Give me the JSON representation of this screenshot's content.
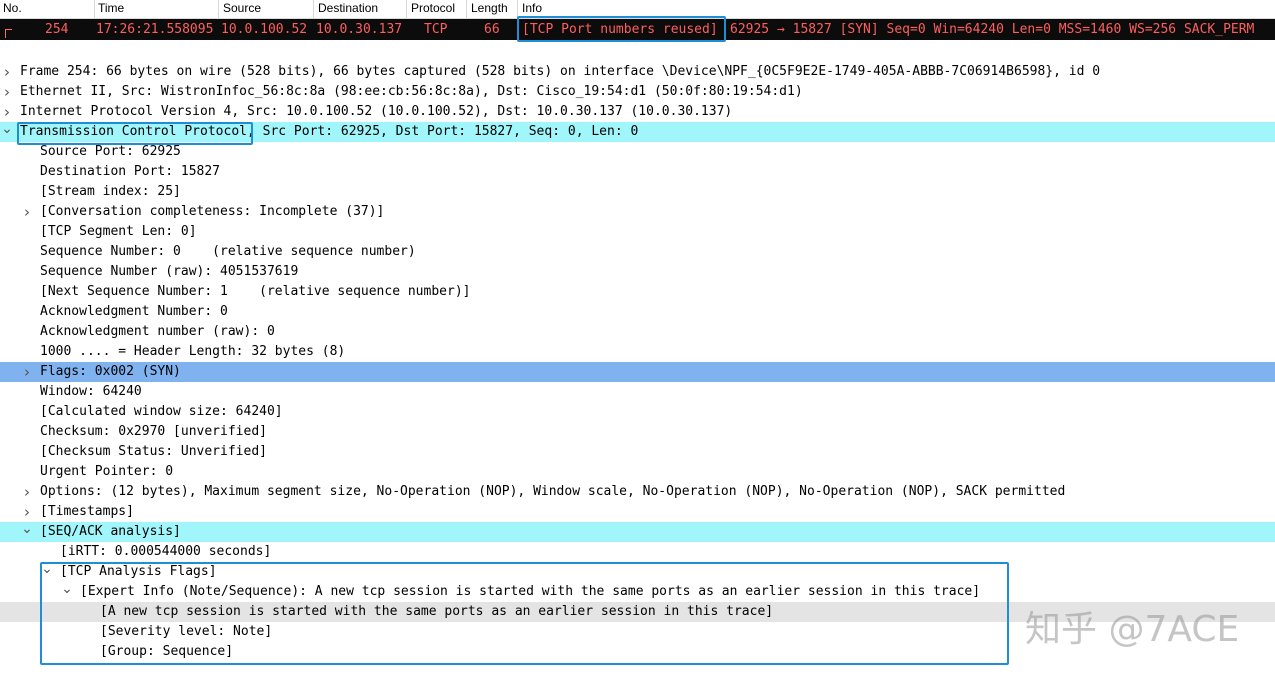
{
  "packet_list": {
    "columns": [
      "No.",
      "Time",
      "Source",
      "Destination",
      "Protocol",
      "Length",
      "Info"
    ],
    "selected_row": {
      "no": "254",
      "time": "17:26:21.558095",
      "source": "10.0.100.52",
      "destination": "10.0.30.137",
      "protocol": "TCP",
      "length": "66",
      "info_flag": "[TCP Port numbers reused]",
      "info_rest": "62925 → 15827 [SYN] Seq=0 Win=64240 Len=0 MSS=1460 WS=256 SACK_PERM"
    },
    "colors": {
      "row_bg": "#0c0c0c",
      "row_fg": "#ff5e5e",
      "highlight_box": "#1e8fd7"
    }
  },
  "details": [
    {
      "text": "Frame 254: 66 bytes on wire (528 bits), 66 bytes captured (528 bits) on interface \\Device\\NPF_{0C5F9E2E-1749-405A-ABBB-7C06914B6598}, id 0",
      "arrow": "collapsed"
    },
    {
      "text": "Ethernet II, Src: WistronInfoc_56:8c:8a (98:ee:cb:56:8c:8a), Dst: Cisco_19:54:d1 (50:0f:80:19:54:d1)",
      "arrow": "collapsed"
    },
    {
      "text": "Internet Protocol Version 4, Src: 10.0.100.52 (10.0.100.52), Dst: 10.0.30.137 (10.0.30.137)",
      "arrow": "collapsed"
    },
    {
      "text": "Transmission Control Protocol, Src Port: 62925, Dst Port: 15827, Seq: 0, Len: 0",
      "arrow": "expanded",
      "bg": "cyan"
    },
    {
      "text": "Source Port: 62925",
      "indent": 1
    },
    {
      "text": "Destination Port: 15827",
      "indent": 1
    },
    {
      "text": "[Stream index: 25]",
      "indent": 1
    },
    {
      "text": "[Conversation completeness: Incomplete (37)]",
      "indent": 1,
      "arrow": "collapsed"
    },
    {
      "text": "[TCP Segment Len: 0]",
      "indent": 1
    },
    {
      "text": "Sequence Number: 0    (relative sequence number)",
      "indent": 1
    },
    {
      "text": "Sequence Number (raw): 4051537619",
      "indent": 1
    },
    {
      "text": "[Next Sequence Number: 1    (relative sequence number)]",
      "indent": 1
    },
    {
      "text": "Acknowledgment Number: 0",
      "indent": 1
    },
    {
      "text": "Acknowledgment number (raw): 0",
      "indent": 1
    },
    {
      "text": "1000 .... = Header Length: 32 bytes (8)",
      "indent": 1
    },
    {
      "text": "Flags: 0x002 (SYN)",
      "indent": 1,
      "arrow": "collapsed",
      "bg": "blue"
    },
    {
      "text": "Window: 64240",
      "indent": 1
    },
    {
      "text": "[Calculated window size: 64240]",
      "indent": 1
    },
    {
      "text": "Checksum: 0x2970 [unverified]",
      "indent": 1
    },
    {
      "text": "[Checksum Status: Unverified]",
      "indent": 1
    },
    {
      "text": "Urgent Pointer: 0",
      "indent": 1
    },
    {
      "text": "Options: (12 bytes), Maximum segment size, No-Operation (NOP), Window scale, No-Operation (NOP), No-Operation (NOP), SACK permitted",
      "indent": 1,
      "arrow": "collapsed"
    },
    {
      "text": "[Timestamps]",
      "indent": 1,
      "arrow": "collapsed"
    },
    {
      "text": "[SEQ/ACK analysis]",
      "indent": 1,
      "arrow": "expanded",
      "bg": "cyan"
    },
    {
      "text": "[iRTT: 0.000544000 seconds]",
      "indent": 2
    },
    {
      "text": "[TCP Analysis Flags]",
      "indent": 2,
      "arrow": "expanded"
    },
    {
      "text": "[Expert Info (Note/Sequence): A new tcp session is started with the same ports as an earlier session in this trace]",
      "indent": 3,
      "arrow": "expanded"
    },
    {
      "text": "[A new tcp session is started with the same ports as an earlier session in this trace]",
      "indent": 4,
      "bg": "grey"
    },
    {
      "text": "[Severity level: Note]",
      "indent": 4
    },
    {
      "text": "[Group: Sequence]",
      "indent": 4
    }
  ],
  "watermark": "知乎 @7ACE"
}
